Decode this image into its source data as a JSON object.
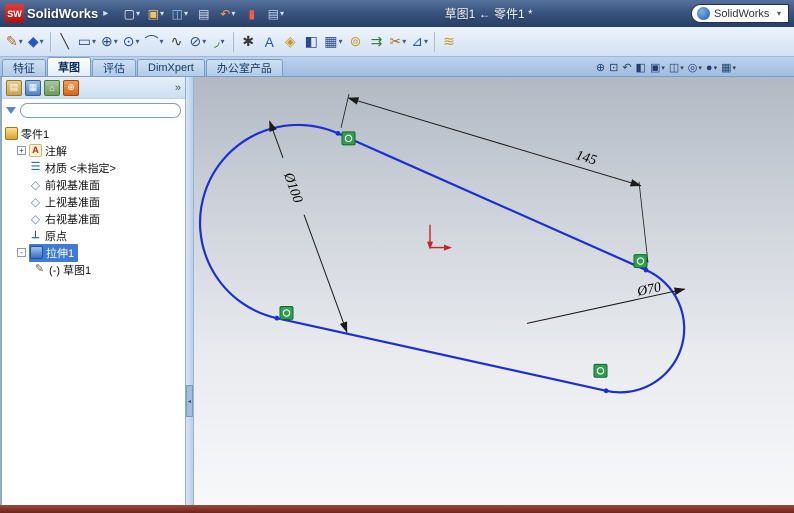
{
  "colors": {
    "sketch_blue": "#1b2fd4",
    "constraint_green": "#2fa14d",
    "origin_red": "#cc2222",
    "selection_blue": "#3f7ad6",
    "statusbar_maroon": "#7b2d26",
    "titlebar_blue": "#3a557f"
  },
  "titlebar": {
    "logo_badge": "SW",
    "logo_text": "SolidWorks",
    "caret": "▸",
    "doc_title": "草图1 ← 零件1 *",
    "search_text": "SolidWorks",
    "icons": [
      {
        "name": "new-document-icon",
        "glyph": "▢"
      },
      {
        "name": "open-icon",
        "glyph": "▣"
      },
      {
        "name": "save-icon",
        "glyph": "◫"
      },
      {
        "name": "print-icon",
        "glyph": "▤"
      },
      {
        "name": "undo-icon",
        "glyph": "↶"
      },
      {
        "name": "rebuild-icon",
        "glyph": "▮"
      },
      {
        "name": "options-icon",
        "glyph": "▤"
      }
    ]
  },
  "sketch_toolbar": {
    "icons": [
      {
        "name": "sketch-tool-icon",
        "glyph": "✎"
      },
      {
        "name": "smart-dimension-icon",
        "glyph": "◆"
      },
      {
        "name": "line-icon",
        "glyph": "╲"
      },
      {
        "name": "rectangle-icon",
        "glyph": "▭"
      },
      {
        "name": "circle-icon",
        "glyph": "⊕"
      },
      {
        "name": "centerpoint-arc-icon",
        "glyph": "⊙"
      },
      {
        "name": "tangent-arc-icon",
        "glyph": "⌒"
      },
      {
        "name": "spline-icon",
        "glyph": "∿"
      },
      {
        "name": "ellipse-icon",
        "glyph": "⊘"
      },
      {
        "name": "sketch-fillet-icon",
        "glyph": "◞"
      },
      {
        "name": "point-icon",
        "glyph": "✱"
      },
      {
        "name": "text-icon",
        "glyph": "A"
      },
      {
        "name": "plane-icon",
        "glyph": "◈"
      },
      {
        "name": "mirror-entities-icon",
        "glyph": "◧"
      },
      {
        "name": "linear-pattern-icon",
        "glyph": "▦"
      },
      {
        "name": "offset-entities-icon",
        "glyph": "⊚"
      },
      {
        "name": "convert-entities-icon",
        "glyph": "⇉"
      },
      {
        "name": "trim-entities-icon",
        "glyph": "✂"
      },
      {
        "name": "display-relations-icon",
        "glyph": "⊿"
      },
      {
        "name": "rapid-sketch-icon",
        "glyph": "≋"
      }
    ]
  },
  "command_tabs": {
    "items": [
      {
        "label": "特征"
      },
      {
        "label": "草图"
      },
      {
        "label": "评估"
      },
      {
        "label": "DimXpert"
      },
      {
        "label": "办公室产品"
      }
    ]
  },
  "view_toolbar": {
    "icons": [
      {
        "name": "zoom-fit-icon",
        "glyph": "⊕"
      },
      {
        "name": "zoom-area-icon",
        "glyph": "⊡"
      },
      {
        "name": "previous-view-icon",
        "glyph": "↶"
      },
      {
        "name": "section-view-icon",
        "glyph": "◧"
      },
      {
        "name": "view-orientation-icon",
        "glyph": "▣"
      },
      {
        "name": "display-style-icon",
        "glyph": "◫"
      },
      {
        "name": "hide-show-items-icon",
        "glyph": "◎"
      },
      {
        "name": "appearance-icon",
        "glyph": "●"
      },
      {
        "name": "view-settings-icon",
        "glyph": "▦"
      }
    ]
  },
  "feature_panel": {
    "chevron": "»",
    "tree": {
      "root_label": "零件1",
      "items": [
        {
          "label": "注解",
          "expand": "+",
          "glyph": "A"
        },
        {
          "label": "材质 <未指定>",
          "glyph": "☰"
        },
        {
          "label": "前视基准面",
          "glyph": "◇"
        },
        {
          "label": "上视基准面",
          "glyph": "◇"
        },
        {
          "label": "右视基准面",
          "glyph": "◇"
        },
        {
          "label": "原点",
          "glyph": "⊥"
        },
        {
          "label": "拉伸1",
          "expand": "-",
          "selected": true
        },
        {
          "label": "(-) 草图1",
          "glyph": "✎"
        }
      ]
    }
  },
  "sketch_view": {
    "dim_diameter_large": "Ø100",
    "dim_length": "145",
    "dim_diameter_small": "Ø70"
  }
}
